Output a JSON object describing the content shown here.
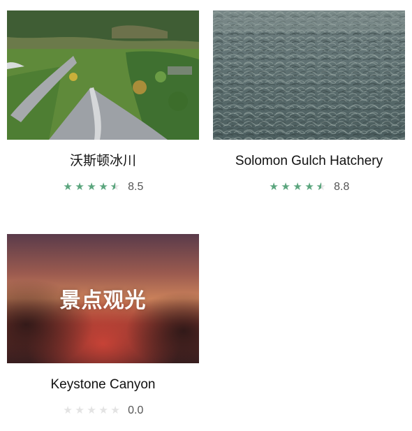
{
  "cards": [
    {
      "title": "沃斯顿冰川",
      "rating": {
        "stars_filled": 4.5,
        "stars_total": 5,
        "score": "8.5"
      },
      "image_description_icon": "glacier-trail-photo"
    },
    {
      "title": "Solomon Gulch Hatchery",
      "rating": {
        "stars_filled": 4.5,
        "stars_total": 5,
        "score": "8.8"
      },
      "image_description_icon": "salmon-river-photo"
    },
    {
      "title": "Keystone Canyon",
      "rating": {
        "stars_filled": 0,
        "stars_total": 5,
        "score": "0.0"
      },
      "image_placeholder_text": "景点观光",
      "image_description_icon": "sightseeing-placeholder-image"
    }
  ],
  "colors": {
    "star_active": "#5aa57d",
    "star_inactive": "#e3e3e3",
    "title_text": "#111111",
    "score_text": "#555555"
  }
}
